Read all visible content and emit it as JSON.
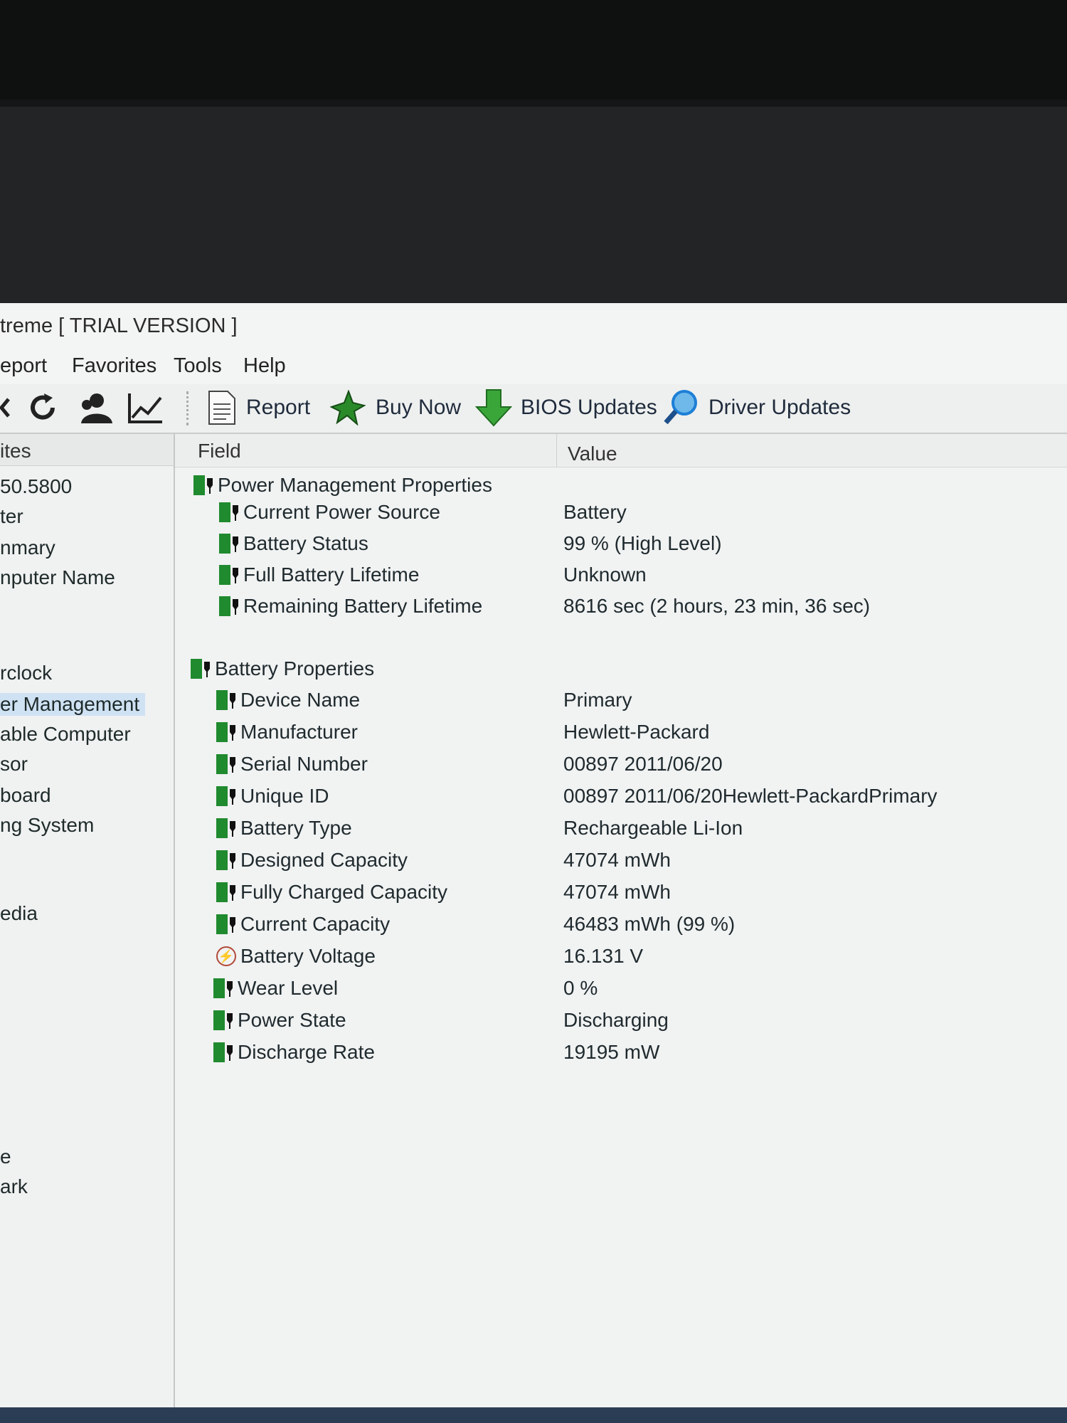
{
  "window": {
    "title": "treme  [ TRIAL VERSION ]"
  },
  "menu": [
    "eport",
    "Favorites",
    "Tools",
    "Help"
  ],
  "toolbar": {
    "report_label": "Report",
    "buy_now_label": "Buy Now",
    "bios_updates_label": "BIOS Updates",
    "driver_updates_label": "Driver Updates"
  },
  "left_panel": {
    "header": "ites",
    "items": [
      "50.5800",
      "ter",
      "nmary",
      "nputer Name",
      "",
      "",
      "rclock",
      "er Management",
      "able Computer",
      "sor",
      "board",
      "ng System",
      "edia",
      "",
      "",
      "e",
      "ark"
    ],
    "selected": "er Management"
  },
  "columns": {
    "field": "Field",
    "value": "Value"
  },
  "power_management": {
    "title": "Power Management Properties",
    "rows": [
      {
        "field": "Current Power Source",
        "value": "Battery"
      },
      {
        "field": "Battery Status",
        "value": "99 % (High Level)"
      },
      {
        "field": "Full Battery Lifetime",
        "value": "Unknown"
      },
      {
        "field": "Remaining Battery Lifetime",
        "value": "8616 sec (2 hours, 23 min, 36 sec)"
      }
    ]
  },
  "battery": {
    "title": "Battery Properties",
    "rows": [
      {
        "field": "Device Name",
        "value": "Primary"
      },
      {
        "field": "Manufacturer",
        "value": "Hewlett-Packard"
      },
      {
        "field": "Serial Number",
        "value": "00897 2011/06/20"
      },
      {
        "field": "Unique ID",
        "value": "00897 2011/06/20Hewlett-PackardPrimary"
      },
      {
        "field": "Battery Type",
        "value": "Rechargeable Li-Ion"
      },
      {
        "field": "Designed Capacity",
        "value": "47074 mWh"
      },
      {
        "field": "Fully Charged Capacity",
        "value": "47074 mWh"
      },
      {
        "field": "Current Capacity",
        "value": "46483 mWh  (99 %)"
      },
      {
        "field": "Battery Voltage",
        "value": "16.131 V"
      },
      {
        "field": "Wear Level",
        "value": "0 %"
      },
      {
        "field": "Power State",
        "value": "Discharging"
      },
      {
        "field": "Discharge Rate",
        "value": "19195 mW"
      }
    ]
  },
  "icons": {
    "battery": "battery-plug-icon",
    "voltage": "voltage-icon",
    "refresh": "refresh-icon",
    "user": "user-icon",
    "chart": "chart-icon",
    "report": "report-icon",
    "buy_now": "buy-now-icon",
    "bios": "bios-download-icon",
    "driver": "driver-search-icon"
  },
  "colors": {
    "battery_green": "#1f8a2e",
    "selected_bg": "#cfe2f3",
    "download_green": "#3aa63a",
    "search_blue": "#1d7fd6"
  }
}
